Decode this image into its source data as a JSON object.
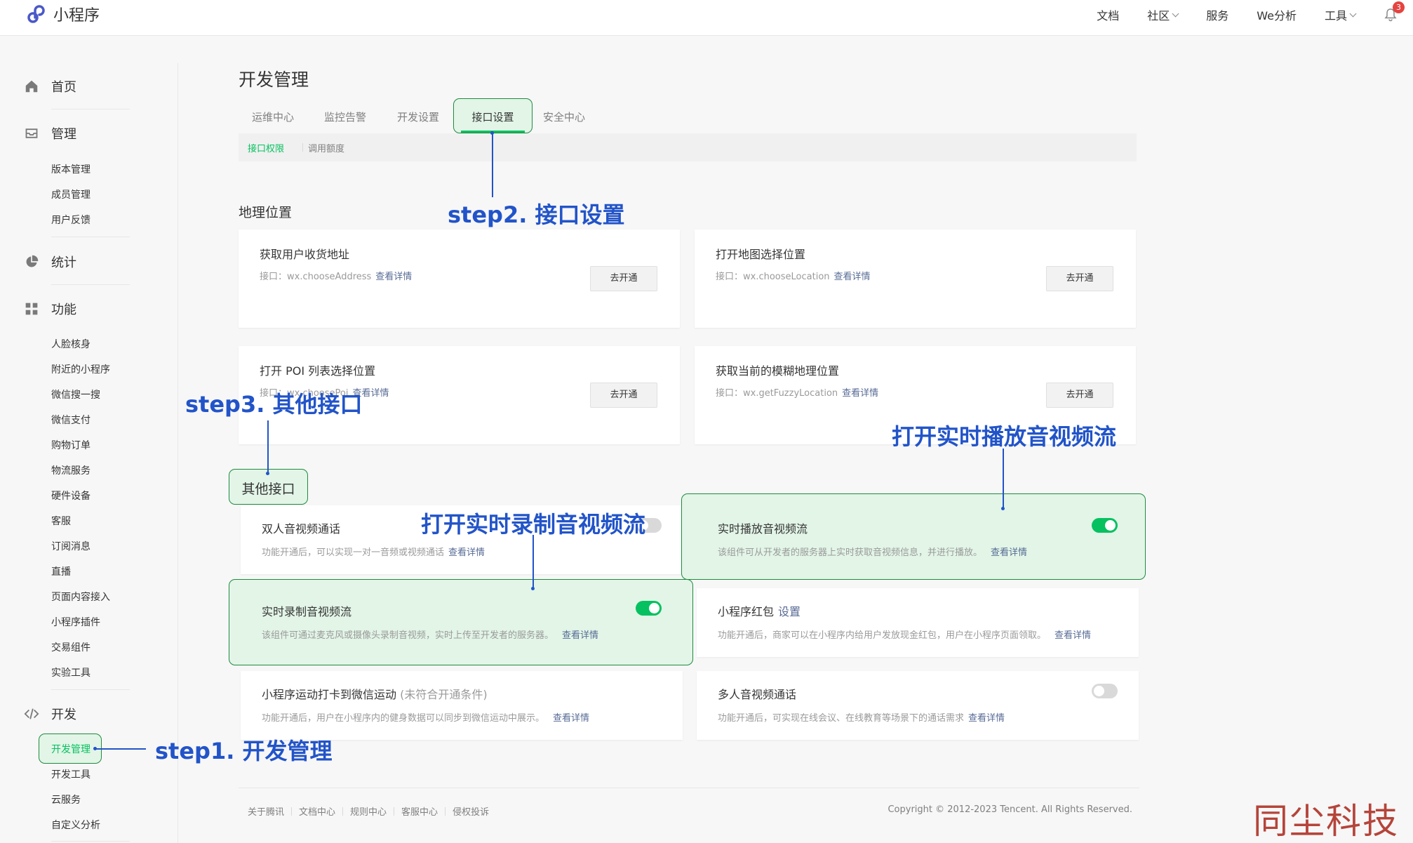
{
  "app": {
    "logo_text": "小程序"
  },
  "topnav": {
    "items": [
      "文档",
      "社区",
      "服务",
      "We分析",
      "工具"
    ],
    "notification_count": "3"
  },
  "sidebar": {
    "home": "首页",
    "manage": "管理",
    "manage_items": [
      "版本管理",
      "成员管理",
      "用户反馈"
    ],
    "stats": "统计",
    "features": "功能",
    "feature_items": [
      "人脸核身",
      "附近的小程序",
      "微信搜一搜",
      "微信支付",
      "购物订单",
      "物流服务",
      "硬件设备",
      "客服",
      "订阅消息",
      "直播",
      "页面内容接入",
      "小程序插件",
      "交易组件",
      "实验工具"
    ],
    "dev": "开发",
    "dev_items": [
      "开发管理",
      "开发工具",
      "云服务",
      "自定义分析"
    ],
    "active_item": "开发管理"
  },
  "main": {
    "page_title": "开发管理",
    "tabs": [
      "运维中心",
      "监控告警",
      "开发设置",
      "接口设置",
      "安全中心"
    ],
    "active_tab": "接口设置",
    "subtabs": [
      "接口权限",
      "调用额度"
    ],
    "geo_section_title": "地理位置",
    "geo_cards": [
      {
        "title": "获取用户收货地址",
        "desc": "接口：wx.chooseAddress",
        "link": "查看详情",
        "button": "去开通"
      },
      {
        "title": "打开地图选择位置",
        "desc": "接口：wx.chooseLocation",
        "link": "查看详情",
        "button": "去开通"
      },
      {
        "title": "打开 POI 列表选择位置",
        "desc": "接口：wx.choosePoi",
        "link": "查看详情",
        "button": "去开通"
      },
      {
        "title": "获取当前的模糊地理位置",
        "desc": "接口：wx.getFuzzyLocation",
        "link": "查看详情",
        "button": "去开通"
      }
    ],
    "other_section_title": "其他接口",
    "other_cards": [
      {
        "title": "双人音视频通话",
        "desc": "功能开通后，可以实现一对一音频或视频通话",
        "link": "查看详情",
        "toggle": "off"
      },
      {
        "title": "实时播放音视频流",
        "desc": "该组件可从开发者的服务器上实时获取音视频信息，并进行播放。",
        "link": "查看详情",
        "toggle": "on"
      },
      {
        "title": "实时录制音视频流",
        "desc": "该组件可通过麦克风或摄像头录制音视频，实时上传至开发者的服务器。",
        "link": "查看详情",
        "toggle": "on"
      },
      {
        "title": "小程序红包",
        "title_link": "设置",
        "desc": "功能开通后，商家可以在小程序内给用户发放现金红包，用户在小程序页面领取。",
        "link": "查看详情"
      },
      {
        "title": "小程序运动打卡到微信运动",
        "title_note": "(未符合开通条件)",
        "desc": "功能开通后，用户在小程序内的健身数据可以同步到微信运动中展示。",
        "link": "查看详情"
      },
      {
        "title": "多人音视频通话",
        "desc": "功能开通后，可实现在线会议、在线教育等场景下的通话需求",
        "link": "查看详情",
        "toggle": "off"
      }
    ]
  },
  "annotations": {
    "step1": "step1. 开发管理",
    "step2": "step2. 接口设置",
    "step3": "step3. 其他接口",
    "play_stream": "打开实时播放音视频流",
    "record_stream": "打开实时录制音视频流"
  },
  "footer": {
    "links": [
      "关于腾讯",
      "文档中心",
      "规则中心",
      "客服中心",
      "侵权投诉"
    ],
    "copyright": "Copyright © 2012-2023 Tencent. All Rights Reserved."
  },
  "watermark": "同尘科技",
  "colors": {
    "accent_green": "#07c160",
    "annotation_blue": "#2254c9",
    "highlight_border": "#1f8a3e",
    "highlight_fill": "#e2f5e7",
    "link_blue": "#576b95"
  }
}
